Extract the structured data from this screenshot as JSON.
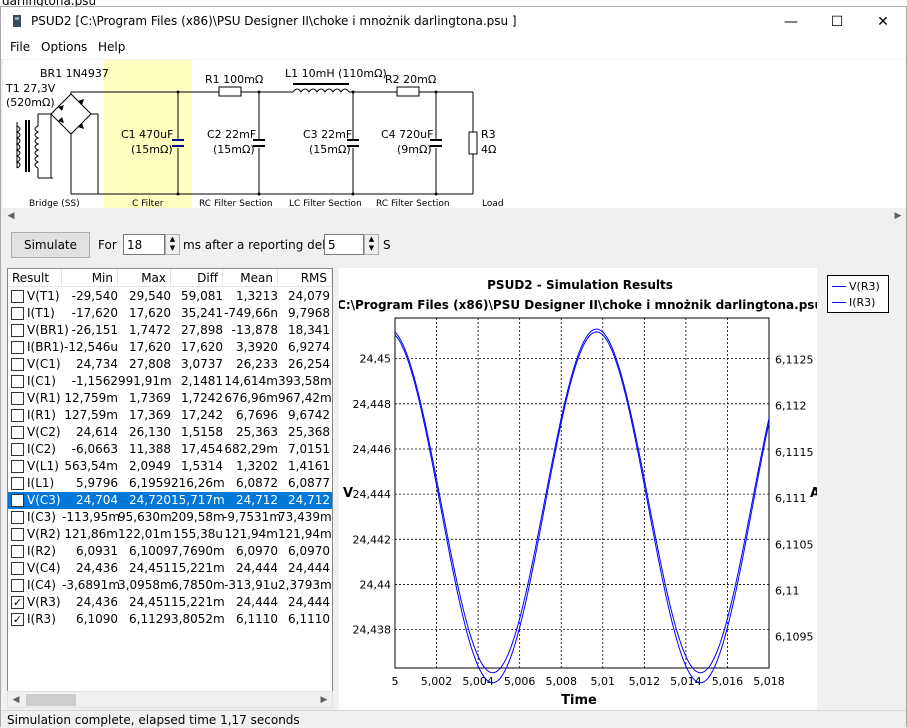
{
  "bg_window": {
    "title": "darlingtona.psu"
  },
  "window": {
    "title": "PSUD2  [C:\\Program Files (x86)\\PSU Designer II\\choke i mnożnik darlingtona.psu ]",
    "minimize": "—",
    "maximize": "☐",
    "close": "✕"
  },
  "menu": [
    "File",
    "Options",
    "Help"
  ],
  "schematic": {
    "t1_label": "T1 27,3V",
    "t1_r": "(520mΩ)",
    "br1": "BR1 1N4937",
    "c1": "C1 470uF",
    "c1_r": "(15mΩ)",
    "r1": "R1 100mΩ",
    "c2": "C2 22mF",
    "c2_r": "(15mΩ)",
    "l1": "L1 10mH (110mΩ)",
    "c3": "C3 22mF",
    "c3_r": "(15mΩ)",
    "r2": "R2 20mΩ",
    "c4": "C4 720uF",
    "c4_r": "(9mΩ)",
    "r3": "R3",
    "r3_v": "4Ω",
    "sections": [
      "Bridge (SS)",
      "C Filter",
      "RC Filter Section",
      "LC Filter Section",
      "RC Filter Section",
      "Load"
    ]
  },
  "controls": {
    "simulate": "Simulate",
    "for": "For",
    "duration": "18",
    "ms_delay": "ms  after a reporting delay of",
    "delay": "5",
    "s": "S"
  },
  "table": {
    "headers": [
      "Result",
      "Min",
      "Max",
      "Diff",
      "Mean",
      "RMS"
    ],
    "rows": [
      {
        "name": "V(T1)",
        "min": "-29,540",
        "max": "29,540",
        "diff": "59,081",
        "mean": "1,3213",
        "rms": "24,079",
        "checked": false,
        "selected": false
      },
      {
        "name": "I(T1)",
        "min": "-17,620",
        "max": "17,620",
        "diff": "35,241",
        "mean": "-749,66n",
        "rms": "9,7968",
        "checked": false,
        "selected": false
      },
      {
        "name": "V(BR1)",
        "min": "-26,151",
        "max": "1,7472",
        "diff": "27,898",
        "mean": "-13,878",
        "rms": "18,341",
        "checked": false,
        "selected": false
      },
      {
        "name": "I(BR1)",
        "min": "-12,546u",
        "max": "17,620",
        "diff": "17,620",
        "mean": "3,3920",
        "rms": "6,9274",
        "checked": false,
        "selected": false
      },
      {
        "name": "V(C1)",
        "min": "24,734",
        "max": "27,808",
        "diff": "3,0737",
        "mean": "26,233",
        "rms": "26,254",
        "checked": false,
        "selected": false
      },
      {
        "name": "I(C1)",
        "min": "-1,1562",
        "max": "991,91m",
        "diff": "2,1481",
        "mean": "14,614m",
        "rms": "393,58m",
        "checked": false,
        "selected": false
      },
      {
        "name": "V(R1)",
        "min": "12,759m",
        "max": "1,7369",
        "diff": "1,7242",
        "mean": "676,96m",
        "rms": "967,42m",
        "checked": false,
        "selected": false
      },
      {
        "name": "I(R1)",
        "min": "127,59m",
        "max": "17,369",
        "diff": "17,242",
        "mean": "6,7696",
        "rms": "9,6742",
        "checked": false,
        "selected": false
      },
      {
        "name": "V(C2)",
        "min": "24,614",
        "max": "26,130",
        "diff": "1,5158",
        "mean": "25,363",
        "rms": "25,368",
        "checked": false,
        "selected": false
      },
      {
        "name": "I(C2)",
        "min": "-6,0663",
        "max": "11,388",
        "diff": "17,454",
        "mean": "682,29m",
        "rms": "7,0151",
        "checked": false,
        "selected": false
      },
      {
        "name": "V(L1)",
        "min": "563,54m",
        "max": "2,0949",
        "diff": "1,5314",
        "mean": "1,3202",
        "rms": "1,4161",
        "checked": false,
        "selected": false
      },
      {
        "name": "I(L1)",
        "min": "5,9796",
        "max": "6,1959",
        "diff": "216,26m",
        "mean": "6,0872",
        "rms": "6,0877",
        "checked": false,
        "selected": false
      },
      {
        "name": "V(C3)",
        "min": "24,704",
        "max": "24,720",
        "diff": "15,717m",
        "mean": "24,712",
        "rms": "24,712",
        "checked": false,
        "selected": true
      },
      {
        "name": "I(C3)",
        "min": "-113,95m",
        "max": "95,630m",
        "diff": "209,58m",
        "mean": "-9,7531m",
        "rms": "73,439m",
        "checked": false,
        "selected": false
      },
      {
        "name": "V(R2)",
        "min": "121,86m",
        "max": "122,01m",
        "diff": "155,38u",
        "mean": "121,94m",
        "rms": "121,94m",
        "checked": false,
        "selected": false
      },
      {
        "name": "I(R2)",
        "min": "6,0931",
        "max": "6,1009",
        "diff": "7,7690m",
        "mean": "6,0970",
        "rms": "6,0970",
        "checked": false,
        "selected": false
      },
      {
        "name": "V(C4)",
        "min": "24,436",
        "max": "24,451",
        "diff": "15,221m",
        "mean": "24,444",
        "rms": "24,444",
        "checked": false,
        "selected": false
      },
      {
        "name": "I(C4)",
        "min": "-3,6891m",
        "max": "3,0958m",
        "diff": "6,7850m",
        "mean": "-313,91u",
        "rms": "2,3793m",
        "checked": false,
        "selected": false
      },
      {
        "name": "V(R3)",
        "min": "24,436",
        "max": "24,451",
        "diff": "15,221m",
        "mean": "24,444",
        "rms": "24,444",
        "checked": true,
        "selected": false
      },
      {
        "name": "I(R3)",
        "min": "6,1090",
        "max": "6,1129",
        "diff": "3,8052m",
        "mean": "6,1110",
        "rms": "6,1110",
        "checked": true,
        "selected": false
      }
    ]
  },
  "chart_data": {
    "type": "line",
    "title": "PSUD2 - Simulation Results",
    "subtitle": "C:\\Program Files (x86)\\PSU Designer II\\choke i mnożnik darlingtona.psu",
    "xlabel": "Time",
    "ylabel_left": "V",
    "ylabel_right": "A",
    "xlim": [
      5,
      5.018
    ],
    "ylim_left": [
      24.4363,
      24.4518
    ],
    "ylim_right": [
      6.10916,
      6.11295
    ],
    "x_ticks": [
      "5",
      "5,002",
      "5,004",
      "5,006",
      "5,008",
      "5,01",
      "5,012",
      "5,014",
      "5,016",
      "5,018"
    ],
    "y_left_ticks": [
      "24,45",
      "24,448",
      "24,446",
      "24,444",
      "24,442",
      "24,44",
      "24,438"
    ],
    "y_right_ticks": [
      "6,1125",
      "6,112",
      "6,1115",
      "6,111",
      "6,1105",
      "6,11",
      "6,1095"
    ],
    "grid": true,
    "legend_position": "right-top",
    "color": "#0000ff",
    "series": [
      {
        "name": "V(R3)",
        "mean": 24.4437,
        "amplitude": 0.00761,
        "period": 0.01,
        "phase_x": 5.0047
      },
      {
        "name": "I(R3)",
        "mean": 6.1109,
        "amplitude": 0.0019,
        "period": 0.01,
        "phase_x": 5.0047
      }
    ]
  },
  "status": "Simulation complete, elapsed time 1,17 seconds"
}
